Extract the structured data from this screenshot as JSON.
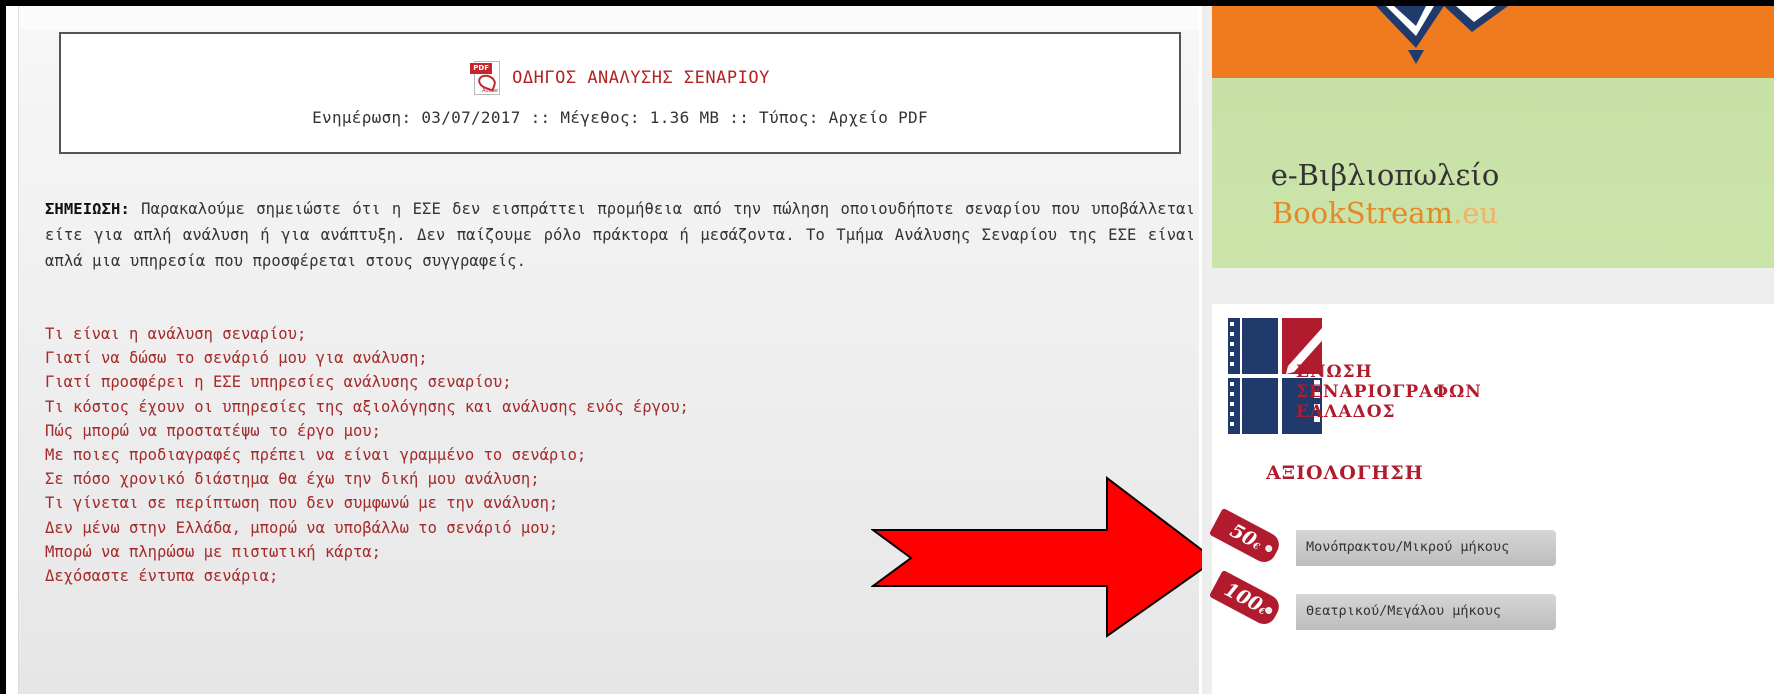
{
  "download": {
    "title": "ΟΔΗΓΟΣ ΑΝΑΛΥΣΗΣ ΣΕΝΑΡΙΟΥ",
    "meta": "Ενημέρωση: 03/07/2017 :: Μέγεθος: 1.36 MB :: Τύπος: Αρχείο PDF",
    "icon": "pdf-icon",
    "icon_tag": "PDF",
    "icon_brand": "Adobe"
  },
  "note": {
    "label": "ΣΗΜΕΙΩΣΗ:",
    "text": "Παρακαλούμε σημειώστε ότι η ΕΣΕ δεν εισπράττει προμήθεια από την πώληση οποιουδήποτε σεναρίου που υποβάλλεται είτε για απλή ανάλυση ή για ανάπτυξη. Δεν παίζουμε ρόλο πράκτορα ή μεσάζοντα. Το Τμήμα Ανάλυσης Σεναρίου της ΕΣΕ είναι απλά μια υπηρεσία που προσφέρεται στους συγγραφείς."
  },
  "faq": [
    "Τι είναι η ανάλυση σεναρίου;",
    "Γιατί να δώσω το σενάριό μου για ανάλυση;",
    "Γιατί προσφέρει η ΕΣΕ υπηρεσίες ανάλυσης σεναρίου;",
    "Τι κόστος έχουν οι υπηρεσίες της αξιολόγησης και ανάλυσης ενός έργου;",
    "Πώς μπορώ να προστατέψω το έργο μου;",
    "Με ποιες προδιαγραφές πρέπει να είναι γραμμένο το σενάριο;",
    "Σε πόσο χρονικό διάστημα θα έχω την δική μου ανάλυση;",
    "Τι γίνεται σε περίπτωση που δεν συμφωνώ με την ανάλυση;",
    "Δεν μένω στην Ελλάδα, μπορώ να υποβάλλω το σενάριό μου;",
    "Μπορώ να πληρώσω με πιστωτική κάρτα;",
    "Δεχόσαστε έντυπα σενάρια;"
  ],
  "sidebar": {
    "bookstore": {
      "title": "e-Βιβλιοπωλείο",
      "brand_main": "BookStream",
      "brand_tld": ".eu"
    },
    "union": {
      "name_line1": "ΕΝΩΣΗ",
      "name_line2": "ΣΕΝΑΡΙΟΓΡΑΦΩΝ",
      "name_line3": "ΕΛΛΑΔΟΣ",
      "section_title": "ΑΞΙΟΛΟΓΗΣΗ",
      "prices": [
        {
          "amount": "50",
          "currency": "€",
          "label": "Μονόπρακτου/Μικρού μήκους"
        },
        {
          "amount": "100",
          "currency": "€",
          "label": "Θεατρικού/Μεγάλου μήκους"
        }
      ]
    }
  },
  "colors": {
    "faq_link": "#a52a2a",
    "title_red": "#b22222",
    "arrow_fill": "#ff0000",
    "brand_orange": "#f07a1e",
    "ese_red": "#b01c2e"
  }
}
